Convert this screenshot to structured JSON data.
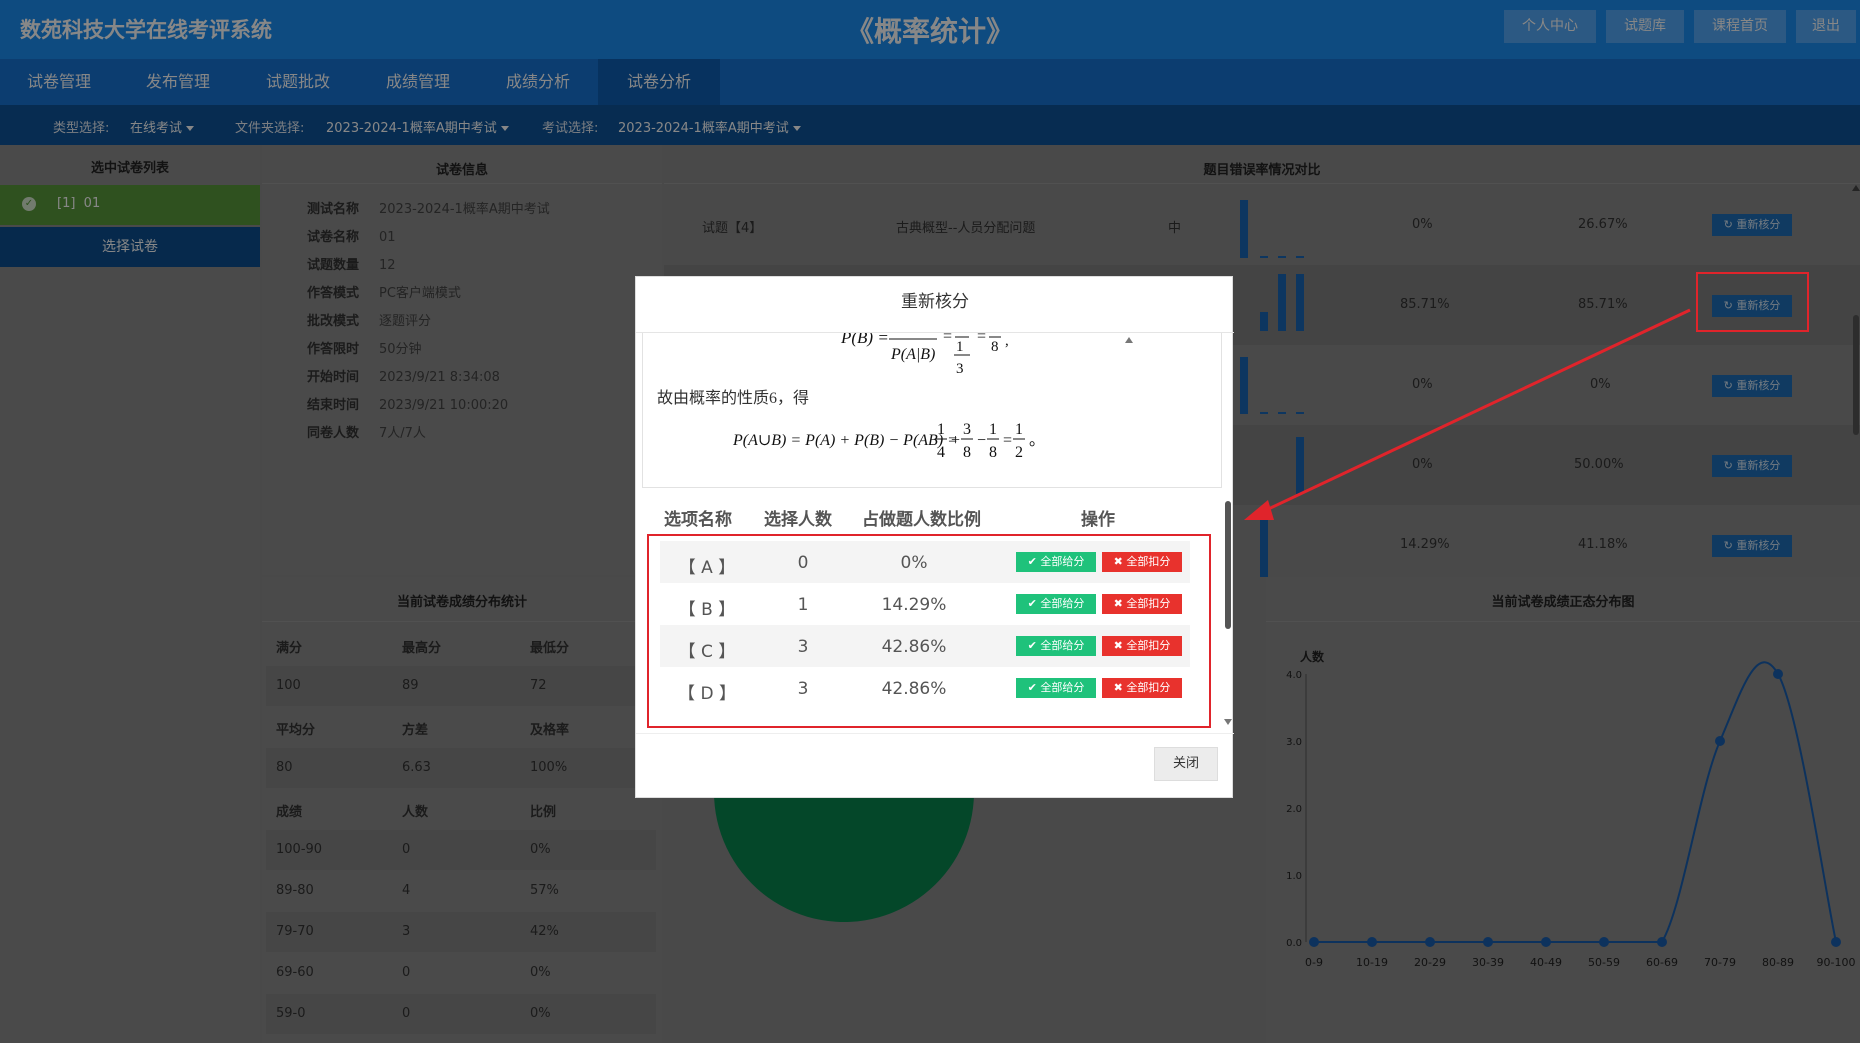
{
  "header": {
    "system_name": "数苑科技大学在线考评系统",
    "course_title": "《概率统计》",
    "buttons": [
      "个人中心",
      "试题库",
      "课程首页",
      "退出"
    ]
  },
  "tabs": [
    {
      "label": "试卷管理"
    },
    {
      "label": "发布管理"
    },
    {
      "label": "试题批改"
    },
    {
      "label": "成绩管理"
    },
    {
      "label": "成绩分析"
    },
    {
      "label": "试卷分析",
      "active": true
    }
  ],
  "filters": {
    "type_label": "类型选择:",
    "type_value": "在线考试",
    "folder_label": "文件夹选择:",
    "folder_value": "2023-2024-1概率A期中考试",
    "exam_label": "考试选择:",
    "exam_value": "2023-2024-1概率A期中考试"
  },
  "left_panel": {
    "title": "选中试卷列表",
    "selected_item": "[1]  01",
    "select_button": "选择试卷"
  },
  "info_panel": {
    "title": "试卷信息",
    "rows": [
      {
        "key": "测试名称",
        "value": "2023-2024-1概率A期中考试"
      },
      {
        "key": "试卷名称",
        "value": "01"
      },
      {
        "key": "试题数量",
        "value": "12"
      },
      {
        "key": "作答模式",
        "value": "PC客户端模式"
      },
      {
        "key": "批改模式",
        "value": "逐题评分"
      },
      {
        "key": "作答限时",
        "value": "50分钟"
      },
      {
        "key": "开始时间",
        "value": "2023/9/21 8:34:08"
      },
      {
        "key": "结束时间",
        "value": "2023/9/21 10:00:20"
      },
      {
        "key": "同卷人数",
        "value": "7人/7人"
      }
    ]
  },
  "error_panel": {
    "title": "题目错误率情况对比",
    "rows": [
      {
        "question": "试题【4】",
        "desc": "古典概型--人员分配问题",
        "level": "中",
        "rate1": "0%",
        "rate2": "26.67%",
        "bars": [
          1,
          0,
          0,
          0
        ]
      },
      {
        "question": "",
        "desc": "",
        "level": "",
        "rate1": "85.71%",
        "rate2": "85.71%",
        "bars": [
          0,
          0.25,
          0.75,
          0.75
        ]
      },
      {
        "question": "",
        "desc": "",
        "level": "",
        "rate1": "0%",
        "rate2": "0%",
        "bars": [
          1,
          0,
          0,
          0
        ]
      },
      {
        "question": "",
        "desc": "",
        "level": "",
        "rate1": "0%",
        "rate2": "50.00%",
        "bars": [
          0,
          0,
          0,
          1
        ]
      },
      {
        "question": "",
        "desc": "",
        "level": "",
        "rate1": "14.29%",
        "rate2": "41.18%",
        "bars": [
          0.9,
          0,
          0,
          0
        ]
      }
    ],
    "rescore_label": "重新核分"
  },
  "stats_panel": {
    "title": "当前试卷成绩分布统计",
    "grid": [
      [
        "满分",
        "最高分",
        "最低分"
      ],
      [
        "100",
        "89",
        "72"
      ],
      [
        "平均分",
        "方差",
        "及格率"
      ],
      [
        "80",
        "6.63",
        "100%"
      ],
      [
        "成绩",
        "人数",
        "比例"
      ],
      [
        "100-90",
        "0",
        "0%"
      ],
      [
        "89-80",
        "4",
        "57%"
      ],
      [
        "79-70",
        "3",
        "42%"
      ],
      [
        "69-60",
        "0",
        "0%"
      ],
      [
        "59-0",
        "0",
        "0%"
      ]
    ]
  },
  "pie_panel": {
    "slices": [
      {
        "value": 57,
        "color": "#08864f"
      },
      {
        "value": 43,
        "color": "#8a6a10"
      }
    ]
  },
  "curve_panel": {
    "title": "当前试卷成绩正态分布图"
  },
  "chart_data": {
    "type": "line",
    "ylabel": "人数",
    "categories": [
      "0-9",
      "10-19",
      "20-29",
      "30-39",
      "40-49",
      "50-59",
      "60-69",
      "70-79",
      "80-89",
      "90-100"
    ],
    "values": [
      0,
      0,
      0,
      0,
      0,
      0,
      0,
      3,
      4,
      0
    ],
    "ylim": [
      0,
      4
    ],
    "yticks": [
      "0.0",
      "1.0",
      "2.0",
      "3.0",
      "4.0"
    ],
    "color": "#1a5fb0"
  },
  "modal": {
    "title": "重新核分",
    "text_line": "故由概率的性质6，得",
    "columns": [
      "选项名称",
      "选择人数",
      "占做题人数比例",
      "操作"
    ],
    "options": [
      {
        "name": "【 A 】",
        "count": "0",
        "ratio": "0%"
      },
      {
        "name": "【 B 】",
        "count": "1",
        "ratio": "14.29%"
      },
      {
        "name": "【 C 】",
        "count": "3",
        "ratio": "42.86%"
      },
      {
        "name": "【 D 】",
        "count": "3",
        "ratio": "42.86%"
      }
    ],
    "give_all_label": "全部给分",
    "deduct_all_label": "全部扣分",
    "close_label": "关闭"
  },
  "colors": {
    "header": "#1b8ef2",
    "tabs": "#1774d4",
    "filterbar": "#0e5499",
    "green_button": "#1fc27b",
    "red_button": "#e8322d",
    "highlight": "#e0242b"
  }
}
